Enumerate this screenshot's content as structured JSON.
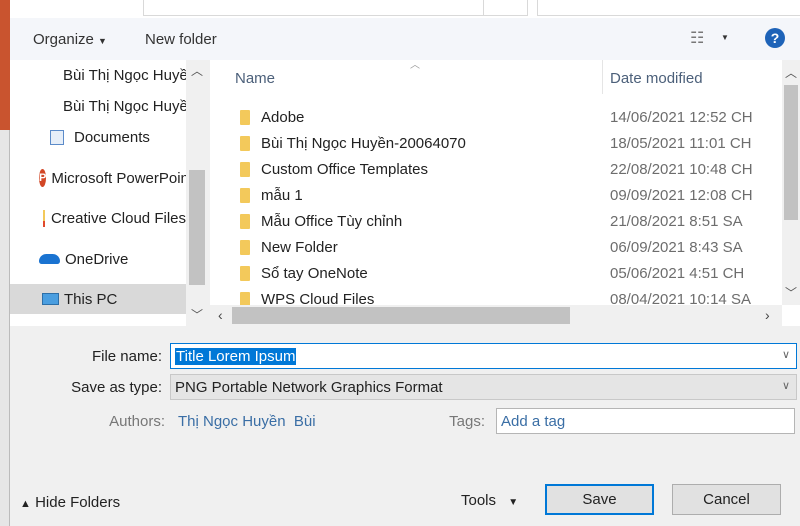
{
  "toolbar": {
    "organize": "Organize",
    "new_folder": "New folder"
  },
  "nav": {
    "items": [
      {
        "label": "Bùi Thị Ngọc Huyền",
        "icon": "folder-icon"
      },
      {
        "label": "Bùi Thị Ngọc Huyền",
        "icon": "folder-icon"
      },
      {
        "label": "Documents",
        "icon": "documents-icon"
      },
      {
        "label": "Microsoft PowerPoint",
        "icon": "powerpoint-icon"
      },
      {
        "label": "Creative Cloud Files",
        "icon": "creative-cloud-icon"
      },
      {
        "label": "OneDrive",
        "icon": "onedrive-icon"
      },
      {
        "label": "This PC",
        "icon": "pc-icon",
        "selected": true
      }
    ]
  },
  "list": {
    "headers": {
      "name": "Name",
      "date": "Date modified"
    },
    "rows": [
      {
        "name": "Adobe",
        "date": "14/06/2021 12:52 CH"
      },
      {
        "name": "Bùi Thị Ngọc Huyền-20064070",
        "date": "18/05/2021 11:01 CH"
      },
      {
        "name": "Custom Office Templates",
        "date": "22/08/2021 10:48 CH"
      },
      {
        "name": "mẫu 1",
        "date": "09/09/2021 12:08 CH"
      },
      {
        "name": "Mẫu Office Tùy chỉnh",
        "date": "21/08/2021 8:51 SA"
      },
      {
        "name": "New Folder",
        "date": "06/09/2021 8:43 SA"
      },
      {
        "name": "Sổ tay OneNote",
        "date": "05/06/2021 4:51 CH"
      },
      {
        "name": "WPS Cloud Files",
        "date": "08/04/2021 10:14 SA"
      }
    ]
  },
  "form": {
    "file_name_label": "File name:",
    "file_name_value": "Title Lorem Ipsum",
    "type_label": "Save as type:",
    "type_value": "PNG Portable Network Graphics Format",
    "authors_label": "Authors:",
    "authors_value": "Thị Ngọc Huyền  Bùi",
    "tags_label": "Tags:",
    "tags_placeholder": "Add a tag"
  },
  "footer": {
    "hide_folders": "Hide Folders",
    "tools": "Tools",
    "save": "Save",
    "cancel": "Cancel"
  },
  "colors": {
    "accent": "#0078d7",
    "selection": "#0078d7",
    "link": "#3a6ea5"
  }
}
